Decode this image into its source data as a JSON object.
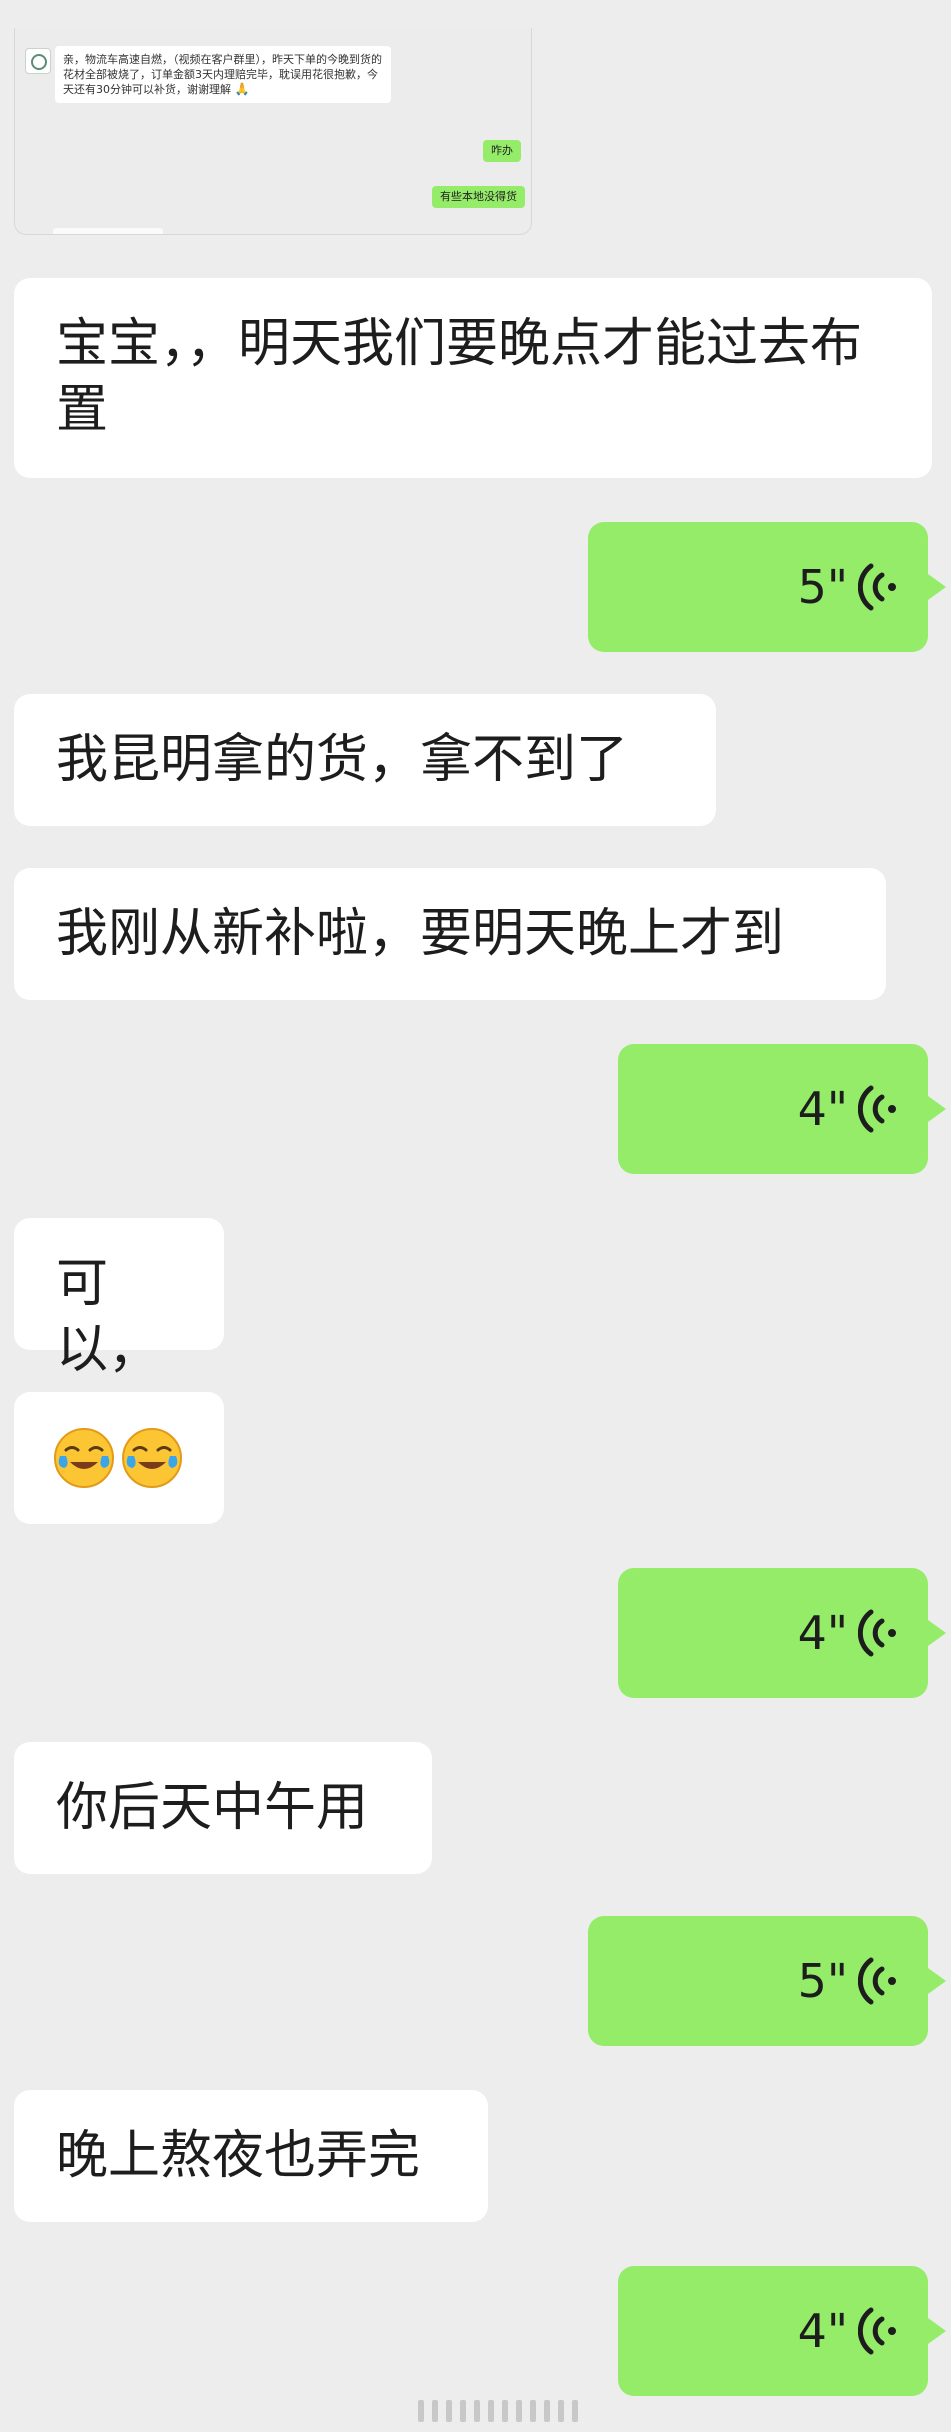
{
  "embedded_screenshot": {
    "notice_text": "亲，物流车高速自燃，（视频在客户群里），昨天下单的今晚到货的花材全部被烧了，订单金额3天内理赔完毕，耽误用花很抱歉，今天还有30分钟可以补货，谢谢理解",
    "notice_emoji": "🙏",
    "reply_1": "咋办",
    "reply_2": "有些本地没得货"
  },
  "messages": [
    {
      "side": "left",
      "type": "text",
      "text": "宝宝，，明天我们要晚点才能过去布置"
    },
    {
      "side": "right",
      "type": "voice",
      "duration": "5\""
    },
    {
      "side": "left",
      "type": "text",
      "text": "我昆明拿的货，拿不到了"
    },
    {
      "side": "left",
      "type": "text",
      "text": "我刚从新补啦，要明天晚上才到"
    },
    {
      "side": "right",
      "type": "voice",
      "duration": "4\""
    },
    {
      "side": "left",
      "type": "text",
      "text": "可以，"
    },
    {
      "side": "left",
      "type": "emoji",
      "icon": "face-with-tears-of-joy-icon"
    },
    {
      "side": "right",
      "type": "voice",
      "duration": "4\""
    },
    {
      "side": "left",
      "type": "text",
      "text": "你后天中午用"
    },
    {
      "side": "right",
      "type": "voice",
      "duration": "5\""
    },
    {
      "side": "left",
      "type": "text",
      "text": "晚上熬夜也弄完"
    },
    {
      "side": "right",
      "type": "voice",
      "duration": "4\""
    }
  ],
  "colors": {
    "background": "#ededed",
    "incoming_bubble": "#ffffff",
    "outgoing_bubble": "#95ec69"
  }
}
